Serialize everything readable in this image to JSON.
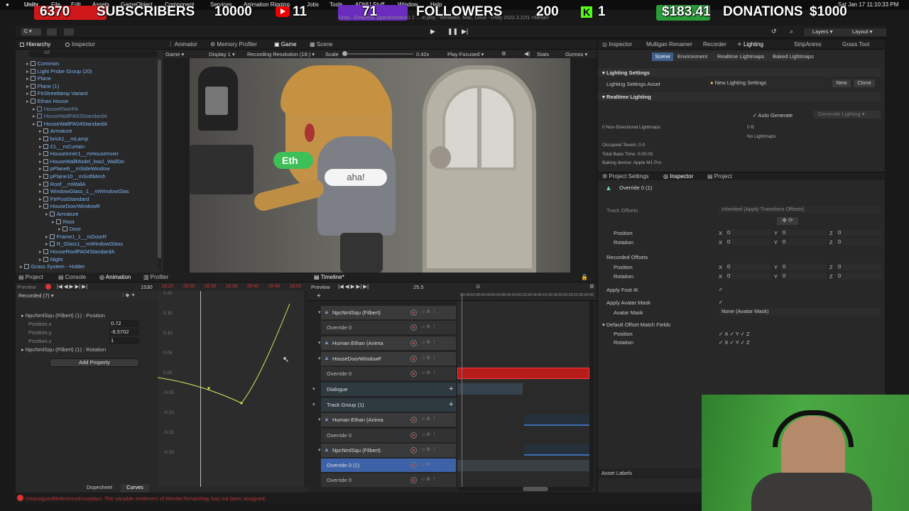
{
  "menubar": {
    "apple": "",
    "app": "Unity",
    "items": [
      "File",
      "Edit",
      "Assets",
      "GameObject",
      "Component",
      "Services",
      "Animation Rigging",
      "Jobs",
      "Tools",
      "ADHU Stuff",
      "Window",
      "Help"
    ],
    "clock": "Sat Jan 17 11:10:33 PM"
  },
  "stream_overlay": {
    "subs_count": "6370",
    "subs_label": "SUBSCRIBERS",
    "subs_goal": "10000",
    "yt_count": "11",
    "followers_count": "71",
    "followers_label": "FOLLOWERS",
    "followers_goal": "200",
    "kick_count": "1",
    "donation_amount": "$183.41",
    "donations_label": "DONATIONS",
    "donation_goal": "$1000"
  },
  "window_title": "Unity - Emiverse SpaceDreams1 2 ... ol.proj - Windows, Mac, Linux - Unity 2022.3.22f1 <Metal>",
  "toolbar": {
    "account": "C",
    "layers": "Layers",
    "layout": "Layout"
  },
  "hierarchy": {
    "tabs": [
      "Hierarchy",
      "Inspector"
    ],
    "search_placeholder": "All",
    "items": [
      {
        "label": "Common",
        "indent": 1,
        "style": "blue"
      },
      {
        "label": "Light Probe Group (20)",
        "indent": 1,
        "style": "blue"
      },
      {
        "label": "Plane",
        "indent": 1,
        "style": "blue"
      },
      {
        "label": "Plane (1)",
        "indent": 1,
        "style": "blue"
      },
      {
        "label": "FtrStreetlamp Variant",
        "indent": 1,
        "style": "blue"
      },
      {
        "label": "Ethan House",
        "indent": 1,
        "style": "blue"
      },
      {
        "label": "HouseFloorPA",
        "indent": 2,
        "style": "dim"
      },
      {
        "label": "HouseWallPA03StandardA",
        "indent": 2,
        "style": "dim"
      },
      {
        "label": "HouseWallPA04StandardA",
        "indent": 2,
        "style": "blue"
      },
      {
        "label": "Armature",
        "indent": 3,
        "style": "blue"
      },
      {
        "label": "brick1__mLamp",
        "indent": 3,
        "style": "blue"
      },
      {
        "label": "CL__mCurtain",
        "indent": 3,
        "style": "blue"
      },
      {
        "label": "HouseInner1__mHouseInner",
        "indent": 3,
        "style": "blue"
      },
      {
        "label": "HouseWallModel_low2_WallDo",
        "indent": 3,
        "style": "blue"
      },
      {
        "label": "pPlane6__mSideWindow",
        "indent": 3,
        "style": "blue"
      },
      {
        "label": "pPlane10__mSoftMesh",
        "indent": 3,
        "style": "blue"
      },
      {
        "label": "Roof__mWallA",
        "indent": 3,
        "style": "blue"
      },
      {
        "label": "WindowGlass_1__mWindowGlas",
        "indent": 3,
        "style": "blue"
      },
      {
        "label": "FtrPostStandard",
        "indent": 3,
        "style": "blue"
      },
      {
        "label": "HouseDoorWindowR",
        "indent": 3,
        "style": "blue"
      },
      {
        "label": "Armature",
        "indent": 4,
        "style": "blue"
      },
      {
        "label": "Root",
        "indent": 5,
        "style": "blue"
      },
      {
        "label": "Door",
        "indent": 6,
        "style": "blue"
      },
      {
        "label": "Frame1_1__mDoorR",
        "indent": 4,
        "style": "blue"
      },
      {
        "label": "R_Glass1__mWindowGlass",
        "indent": 4,
        "style": "blue"
      },
      {
        "label": "HouseRoofPA04StandardA",
        "indent": 3,
        "style": "blue"
      },
      {
        "label": "Night",
        "indent": 3,
        "style": "blue"
      },
      {
        "label": "Grass System - Holder",
        "indent": 0,
        "style": "blue"
      }
    ]
  },
  "center_tabs": [
    "Animator",
    "Memory Profiler",
    "Game",
    "Scene"
  ],
  "game_bar": {
    "mode": "Game",
    "display": "Display 1",
    "resolution": "Recording Resolution (18:",
    "scale_label": "Scale",
    "scale_value": "0.42x",
    "play_focused": "Play Focused",
    "stats": "Stats",
    "gizmos": "Gizmos"
  },
  "game_view": {
    "name_tag": "Eth",
    "speech": "aha!"
  },
  "animation": {
    "tabs": [
      "Project",
      "Console",
      "Animation",
      "Profiler"
    ],
    "preview": "Preview",
    "frame": "1530",
    "recorded": "Recorded (7)",
    "ruler": [
      "25:20",
      "25:25",
      "25:30",
      "25:35",
      "25:40",
      "25:45",
      "25:50"
    ],
    "props": [
      {
        "label": "NpcNmlSqu (Filbert) (1) : Position",
        "value": ""
      },
      {
        "label": "Position.x",
        "value": "0.72"
      },
      {
        "label": "Position.y",
        "value": "-8.5702"
      },
      {
        "label": "Position.z",
        "value": "1"
      },
      {
        "label": "NpcNmlSqu (Filbert) (1) : Rotation",
        "value": ""
      }
    ],
    "add_property": "Add Property",
    "y_ticks": [
      "0.20",
      "0.15",
      "0.10",
      "0.05",
      "0.00",
      "-0.05",
      "-0.10",
      "-0.15",
      "-0.20"
    ],
    "dopesheet": "Dopesheet",
    "curves": "Curves"
  },
  "timeline": {
    "tab": "Timeline*",
    "preview": "Preview",
    "frame": "25.5",
    "ruler": [
      "00:00",
      "02:00",
      "04:00",
      "06:00",
      "08:00",
      "10:00",
      "12:00",
      "14:00",
      "16:00",
      "18:00",
      "20:00",
      "22:00",
      "24:00"
    ],
    "tracks": [
      {
        "label": "NpcNmlSqu (Filbert)",
        "type": "anim",
        "top": 431
      },
      {
        "label": "Override 0",
        "type": "sub",
        "top": 452
      },
      {
        "label": "Human Ethan (Anima",
        "type": "anim",
        "top": 474
      },
      {
        "label": "HouseDoorWindowF",
        "type": "anim",
        "top": 496
      },
      {
        "label": "Override 0",
        "type": "sub",
        "top": 517
      },
      {
        "label": "Dialogue",
        "type": "group",
        "top": 539
      },
      {
        "label": "Track Group (1)",
        "type": "group",
        "top": 561
      },
      {
        "label": "Human Ethan (Anima",
        "type": "anim",
        "top": 582
      },
      {
        "label": "Override 0",
        "type": "sub",
        "top": 604
      },
      {
        "label": "NpcNmlSqu (Filbert)",
        "type": "anim",
        "top": 625
      },
      {
        "label": "Override 0 (1)",
        "type": "sel",
        "top": 646
      },
      {
        "label": "Override 0",
        "type": "sub",
        "top": 667
      }
    ]
  },
  "inspector": {
    "tabs": [
      "Inspector",
      "Mulligan Renamer",
      "Recorder",
      "Lighting",
      "StripAnims",
      "Grass Tool"
    ],
    "lighting_tabs": [
      "Scene",
      "Environment",
      "Realtime Lightmaps",
      "Baked Lightmaps"
    ],
    "lighting_settings": "Lighting Settings",
    "lighting_asset_label": "Lighting Settings Asset",
    "lighting_asset_value": "New Lighting Settings",
    "new_btn": "New",
    "clone_btn": "Clone",
    "realtime_lighting": "Realtime Lighting",
    "auto_generate": "Auto Generate",
    "generate_lighting": "Generate Lighting",
    "stats": [
      {
        "label": "0 Non-Directional Lightmaps",
        "value": "0 B"
      },
      {
        "label": "",
        "value": "No Lightmaps"
      },
      {
        "label": "Occupied Texels: 0.0",
        "value": ""
      },
      {
        "label": "Total Bake Time: 0:00:00",
        "value": ""
      },
      {
        "label": "Baking device: Apple M1 Pro",
        "value": ""
      }
    ],
    "lower_tabs": [
      "Project Settings",
      "Inspector",
      "Project"
    ],
    "object_name": "Override 0 (1)",
    "track_offsets_label": "Track Offsets",
    "track_offsets_value": "Inherited (Apply Transform Offsets)",
    "position": "Position",
    "rotation": "Rotation",
    "recorded_offsets": "Recorded Offsets",
    "xyz": {
      "x": "X",
      "y": "Y",
      "z": "Z",
      "v": "0"
    },
    "apply_foot_ik": "Apply Foot IK",
    "apply_avatar_mask": "Apply Avatar Mask",
    "avatar_mask": "Avatar Mask",
    "avatar_mask_value": "None (Avatar Mask)",
    "default_offset": "Default Offset Match Fields",
    "asset_labels": "Asset Labels"
  },
  "status": {
    "error": "UnassignedReferenceException: The variable renderers of RenderTerrainMap has not been assigned."
  }
}
